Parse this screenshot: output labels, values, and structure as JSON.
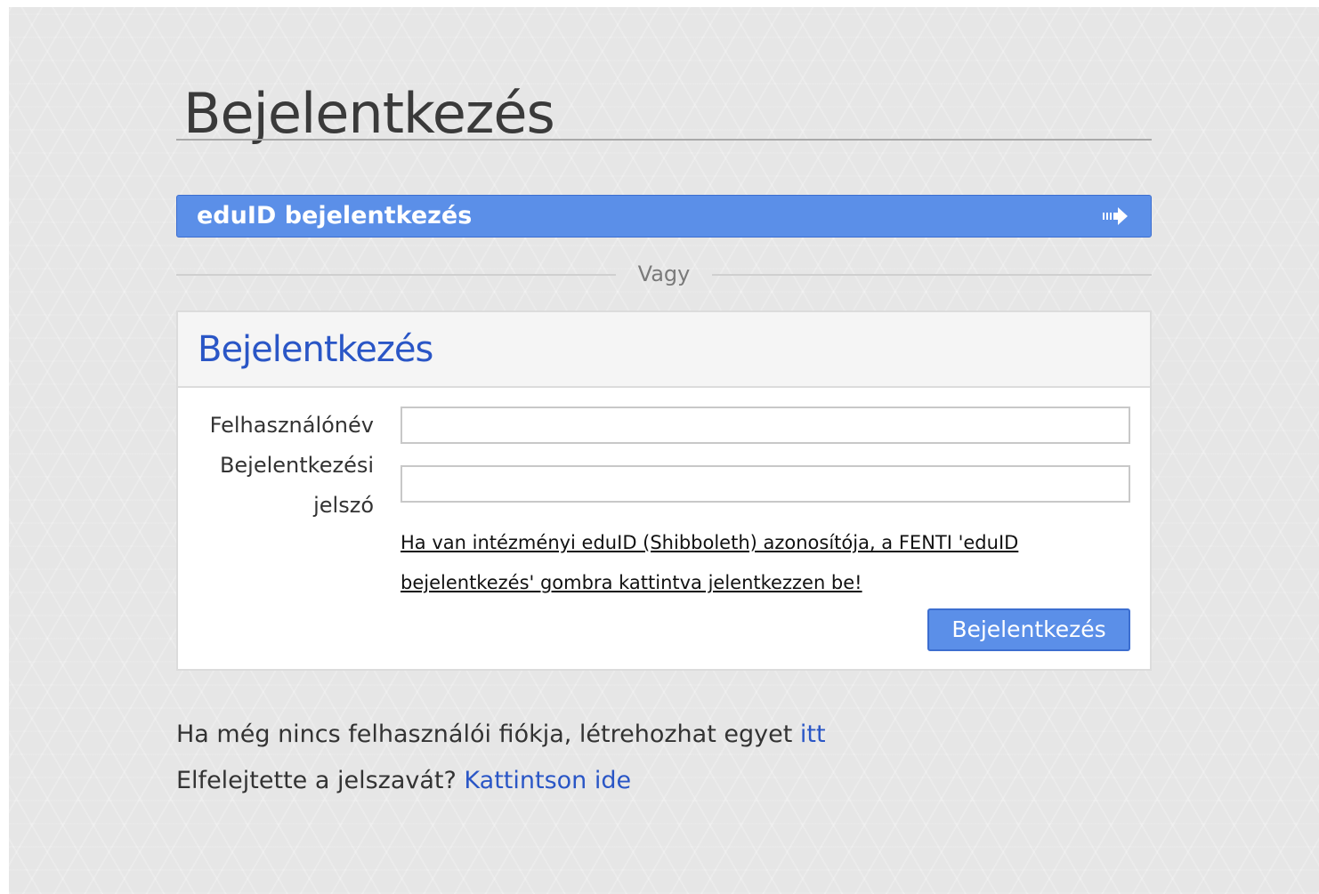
{
  "page": {
    "title": "Bejelentkezés"
  },
  "eduid": {
    "button_label": "eduID bejelentkezés",
    "icon": "arrow-right-icon"
  },
  "divider": {
    "text": "Vagy"
  },
  "login_panel": {
    "title": "Bejelentkezés",
    "username_label": "Felhasználónév",
    "username_value": "",
    "password_label": "Bejelentkezési jelszó",
    "password_value": "",
    "hint_text": "Ha van intézményi eduID (Shibboleth) azonosítója, a FENTI 'eduID bejelentkezés' gombra kattintva jelentkezzen be!",
    "submit_label": "Bejelentkezés"
  },
  "footer": {
    "register_text": "Ha még nincs felhasználói fiókja, létrehozhat egyet",
    "register_link": "itt",
    "forgot_text": "Elfelejtette a jelszavát?",
    "forgot_link": "Kattintson ide"
  },
  "colors": {
    "primary_button": "#5b8fe8",
    "link": "#2a56c6",
    "background": "#e6e6e6"
  }
}
